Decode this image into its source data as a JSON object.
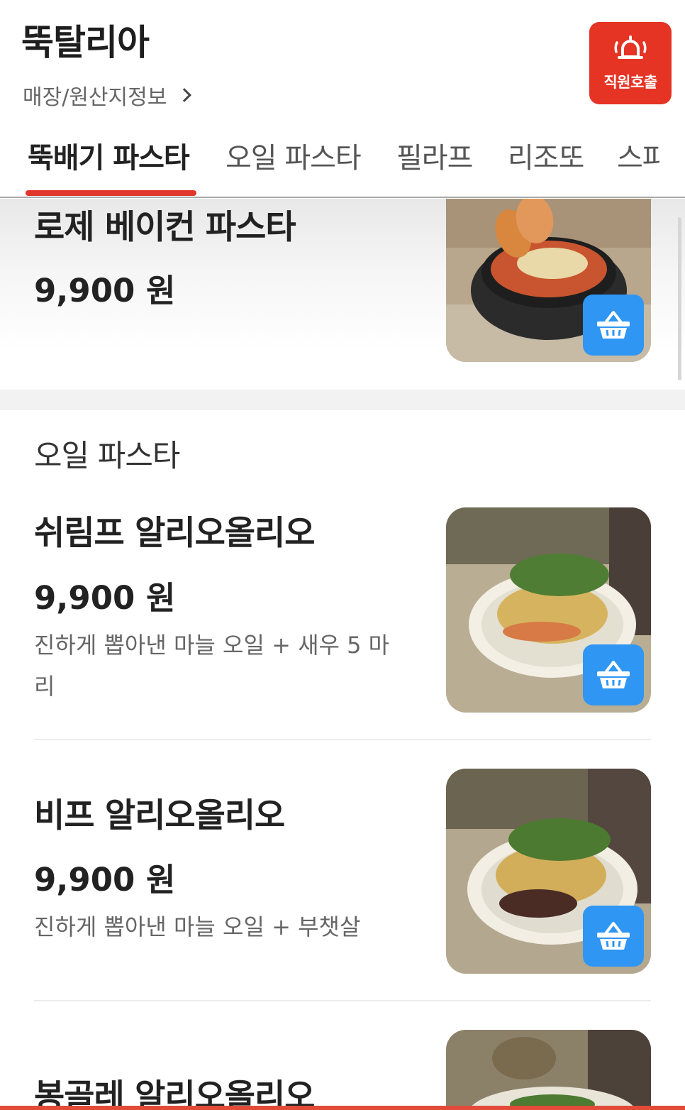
{
  "header": {
    "store_name": "뚝탈리아",
    "store_info_link": "매장/원산지정보",
    "call_staff_label": "직원호출"
  },
  "tabs": [
    {
      "label": "뚝배기 파스타",
      "active": true
    },
    {
      "label": "오일 파스타",
      "active": false
    },
    {
      "label": "필라프",
      "active": false
    },
    {
      "label": "리조또",
      "active": false
    },
    {
      "label": "스파",
      "active": false
    }
  ],
  "menu": {
    "items": [
      {
        "name": "로제 베이컨 파스타",
        "price": "9,900 원",
        "description": ""
      },
      {
        "name": "쉬림프 알리오올리오",
        "price": "9,900 원",
        "description": "진하게 뽑아낸 마늘 오일 + 새우 5 마리"
      },
      {
        "name": "비프 알리오올리오",
        "price": "9,900 원",
        "description": "진하게 뽑아낸 마늘 오일 + 부챗살"
      },
      {
        "name": "봉골레 알리오올리오",
        "price": "",
        "description": ""
      }
    ],
    "sections": [
      {
        "title": "오일 파스타"
      }
    ]
  },
  "icons": {
    "call": "bell-icon",
    "cart": "basket-icon",
    "store_info": "chevron-right-icon"
  },
  "colors": {
    "accent_red": "#e53324",
    "tab_underline": "#e0362b",
    "cart_blue": "#2f96f3"
  }
}
